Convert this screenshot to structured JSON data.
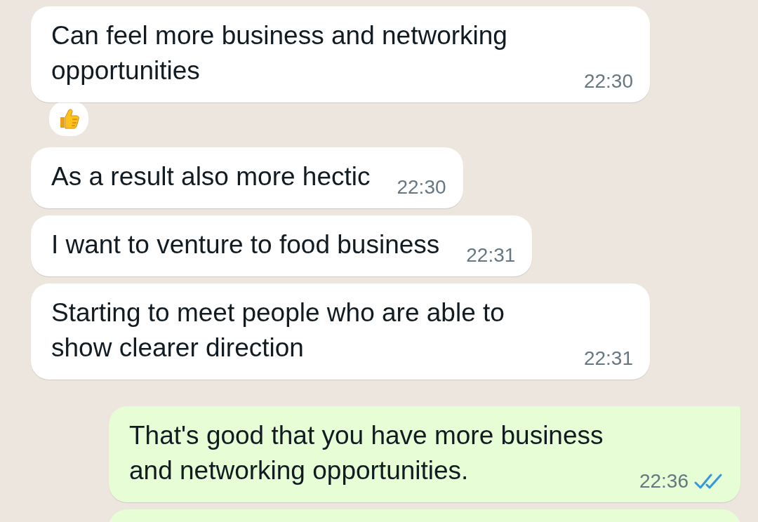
{
  "messages": [
    {
      "kind": "in",
      "text": "Can feel more business and networking opportunities",
      "time": "22:30",
      "reacted": true
    },
    {
      "kind": "in",
      "text": "As a result also more hectic",
      "time": "22:30",
      "reacted": false
    },
    {
      "kind": "in",
      "text": "I want to venture to food business",
      "time": "22:31",
      "reacted": false
    },
    {
      "kind": "in",
      "text": "Starting to meet people who are able to show clearer direction",
      "time": "22:31",
      "reacted": false
    },
    {
      "kind": "out",
      "text": "That's good that you have more business and networking opportunities.",
      "time": "22:36",
      "read": true,
      "reacted": false
    }
  ]
}
